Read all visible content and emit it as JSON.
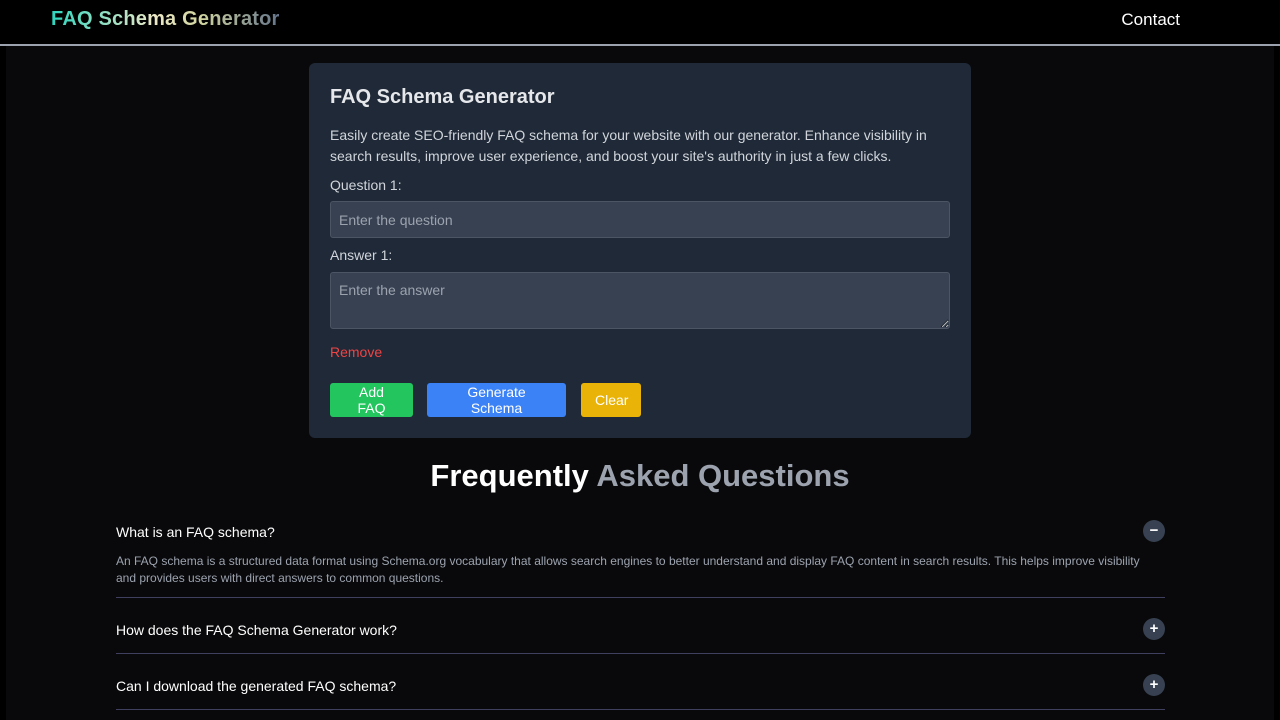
{
  "nav": {
    "brand": "FAQ Schema Generator",
    "contact": "Contact"
  },
  "generator": {
    "title": "FAQ Schema Generator",
    "description": "Easily create SEO-friendly FAQ schema for your website with our generator. Enhance visibility in search results, improve user experience, and boost your site's authority in just a few clicks.",
    "question_label": "Question 1:",
    "question_placeholder": "Enter the question",
    "question_value": "",
    "answer_label": "Answer 1:",
    "answer_placeholder": "Enter the answer",
    "answer_value": "",
    "remove_label": "Remove",
    "add_label": "Add FAQ",
    "generate_label": "Generate Schema",
    "clear_label": "Clear"
  },
  "faq": {
    "heading_part1": "Frequently",
    "heading_part2": "Asked Questions",
    "items": [
      {
        "question": "What is an FAQ schema?",
        "answer": "An FAQ schema is a structured data format using Schema.org vocabulary that allows search engines to better understand and display FAQ content in search results. This helps improve visibility and provides users with direct answers to common questions.",
        "toggle": "−",
        "expanded": true
      },
      {
        "question": "How does the FAQ Schema Generator work?",
        "toggle": "+",
        "expanded": false
      },
      {
        "question": "Can I download the generated FAQ schema?",
        "toggle": "+",
        "expanded": false
      }
    ]
  },
  "colors": {
    "background": "#09090b",
    "card": "#1f2937",
    "add_button": "#22c55e",
    "generate_button": "#3b82f6",
    "clear_button": "#eab308",
    "remove_text": "#ef4444"
  }
}
